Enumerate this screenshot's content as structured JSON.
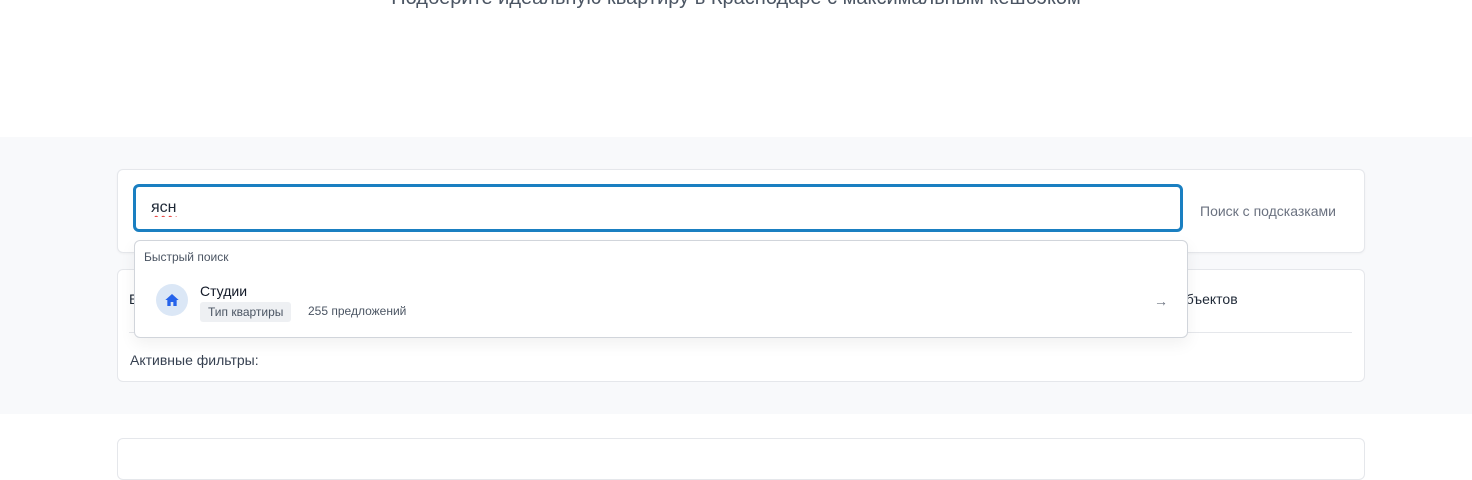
{
  "hero": {
    "subtitle": "Подберите идеальную квартиру в Краснодаре с максимальным кешбэком"
  },
  "search": {
    "value": "ясн",
    "hint_label": "Поиск с подсказками"
  },
  "dropdown": {
    "section_title": "Быстрый поиск",
    "suggestions": [
      {
        "title": "Студии",
        "tag": "Тип квартиры",
        "count": "255 предложений",
        "icon": "home-icon",
        "arrow": "→"
      }
    ]
  },
  "filters": {
    "left_label_visible": "Б",
    "objects_text": "объектов",
    "active_filters_label": "Активные фильтры:"
  },
  "colors": {
    "accent": "#1a7fc1",
    "icon": "#2563eb",
    "icon_bg": "#dbe7f6",
    "band": "#f8f9fb"
  }
}
